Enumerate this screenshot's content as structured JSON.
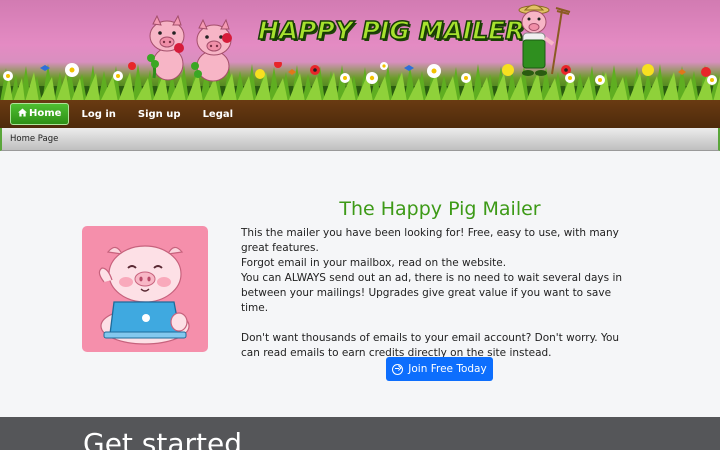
{
  "header": {
    "logo_text": "HAPPY PIG MAILER"
  },
  "nav": {
    "items": [
      {
        "label": "Home",
        "icon": "home-icon",
        "active": true
      },
      {
        "label": "Log in",
        "active": false
      },
      {
        "label": "Sign up",
        "active": false
      },
      {
        "label": "Legal",
        "active": false
      }
    ]
  },
  "breadcrumb": "Home Page",
  "main": {
    "title": "The Happy Pig Mailer",
    "paragraph1": "This the mailer you have been looking for! Free, easy to use, with many great features.",
    "paragraph2": "Forgot email in your mailbox, read on the website.",
    "paragraph3": "You can ALWAYS send out an ad, there is no need to wait several days in between your mailings! Upgrades give great value if you want to save time.",
    "paragraph4": "Don't want thousands of emails to your email account? Don't worry. You can read emails to earn credits directly on the site instead.",
    "join_button": "Join Free Today"
  },
  "section": {
    "heading": "Get started"
  },
  "colors": {
    "accent_green": "#3d9a17",
    "nav_brown": "#5a3310",
    "button_blue": "#0d6efd",
    "card_pink": "#f58fab"
  }
}
